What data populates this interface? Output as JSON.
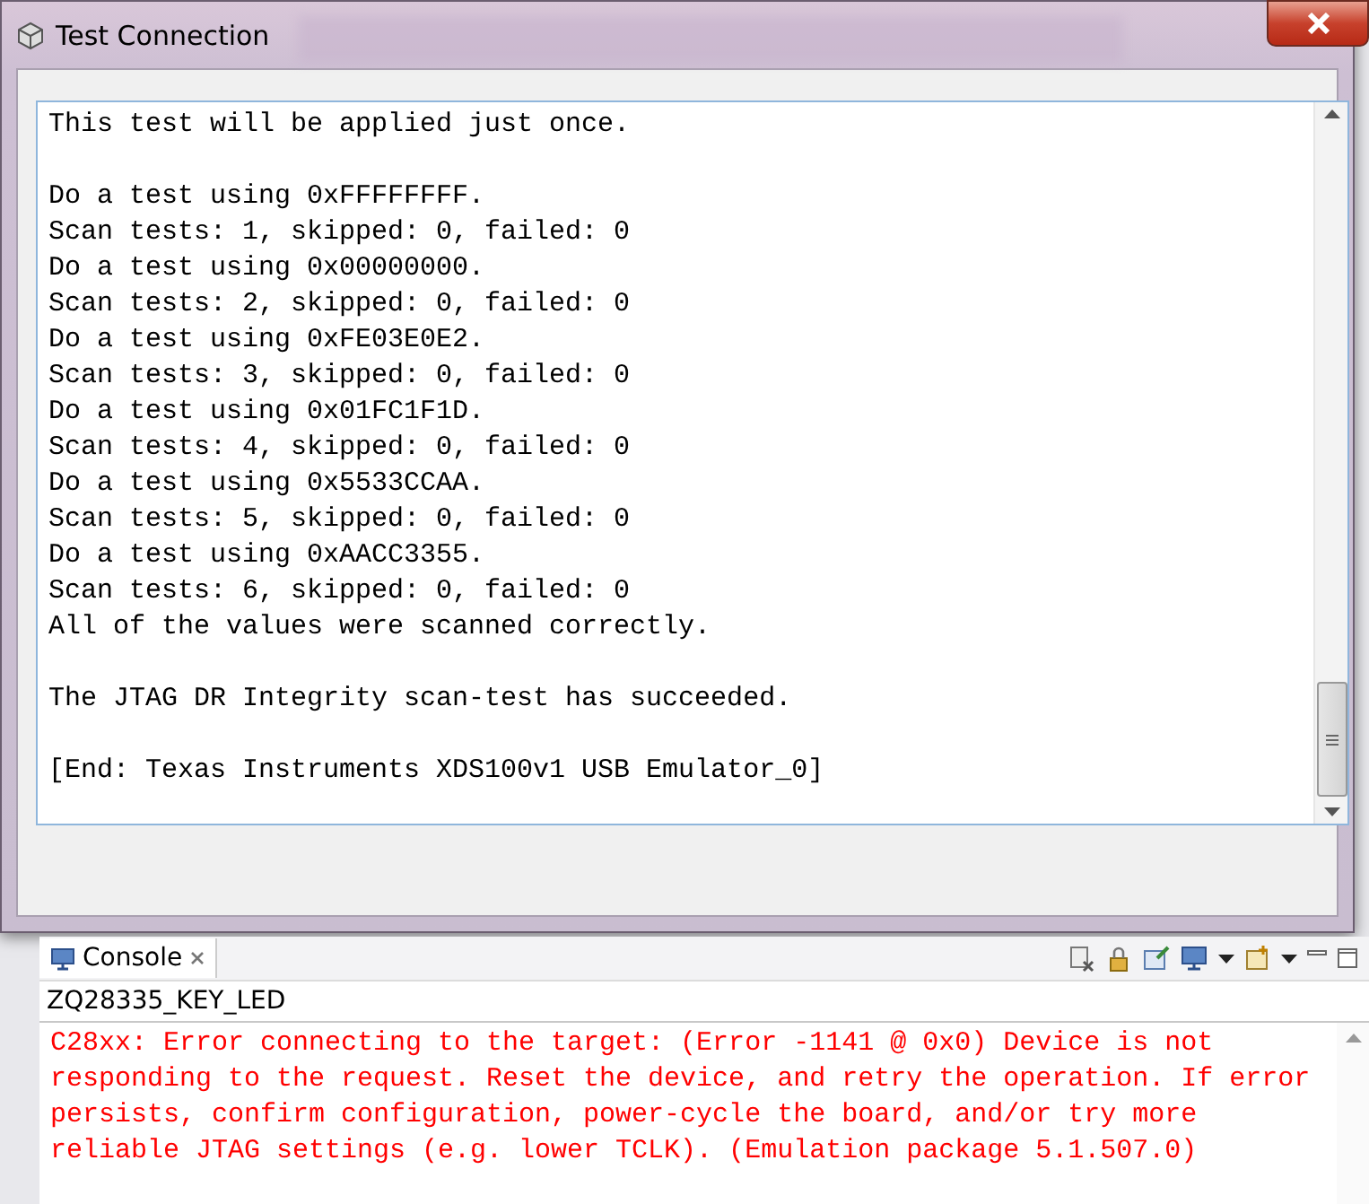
{
  "dialog": {
    "title": "Test Connection",
    "output_blocks": [
      [
        "This test will be applied just once."
      ],
      [
        "Do a test using 0xFFFFFFFF.",
        "Scan tests: 1, skipped: 0, failed: 0",
        "Do a test using 0x00000000.",
        "Scan tests: 2, skipped: 0, failed: 0",
        "Do a test using 0xFE03E0E2.",
        "Scan tests: 3, skipped: 0, failed: 0",
        "Do a test using 0x01FC1F1D.",
        "Scan tests: 4, skipped: 0, failed: 0",
        "Do a test using 0x5533CCAA.",
        "Scan tests: 5, skipped: 0, failed: 0",
        "Do a test using 0xAACC3355.",
        "Scan tests: 6, skipped: 0, failed: 0",
        "All of the values were scanned correctly."
      ],
      [
        "The JTAG DR Integrity scan-test has succeeded."
      ],
      [
        "[End: Texas Instruments XDS100v1 USB Emulator_0]"
      ]
    ]
  },
  "console": {
    "tab": {
      "label": "Console",
      "selected": true
    },
    "project": "ZQ28335_KEY_LED",
    "messages": [
      {
        "kind": "error",
        "lines": [
          "C28xx: Error connecting to the target: (Error -1141 @ 0x0) Device is not",
          "responding to the request. Reset the device, and retry the operation. If error",
          "persists, confirm configuration, power-cycle the board, and/or try more",
          "reliable JTAG settings (e.g. lower TCLK). (Emulation package 5.1.507.0)"
        ]
      }
    ]
  }
}
